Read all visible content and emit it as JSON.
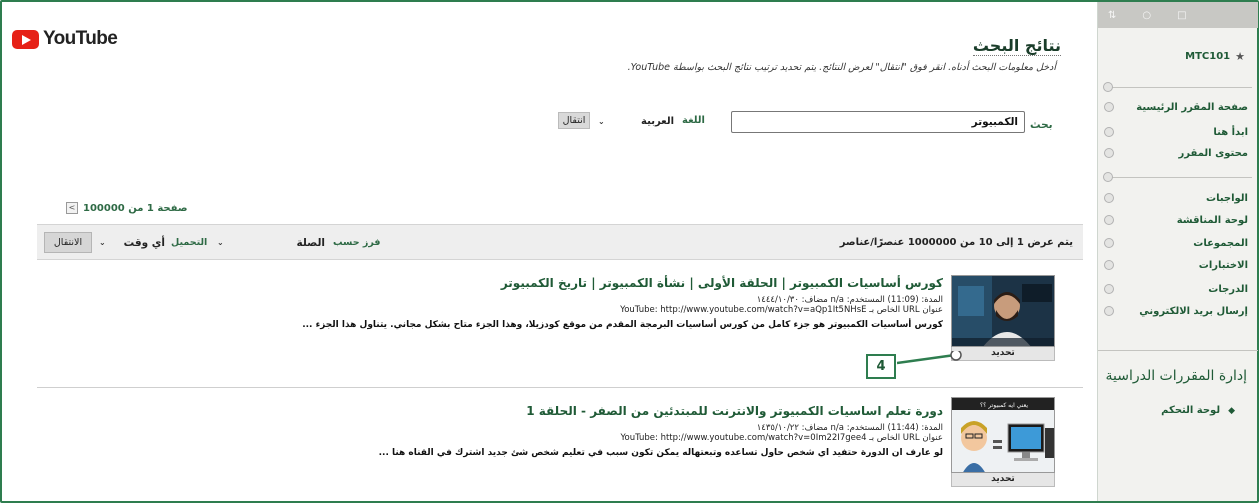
{
  "brand": {
    "logo_text": "YouTube"
  },
  "header": {
    "title": "نتائج البحث",
    "instructions": "أدخل معلومات البحث أدناه. انقر فوق \"انتقال\" لعرض النتائج. يتم تحديد ترتيب نتائج البحث بواسطة YouTube."
  },
  "search": {
    "label": "بحث",
    "value": "الكمبيوتر",
    "language_label": "اللغة",
    "language_value": "العربية",
    "go_label": "انتقال"
  },
  "pager": {
    "text": "صفحة 1 من 100000",
    "arrow": "<"
  },
  "sortbar": {
    "count_text": "يتم عرض 1 إلى 10 من 1000000 عنصرًا/عناصر",
    "sort_label": "فرز حسب",
    "sort_value": "الصلة",
    "upload_label": "التحميل",
    "upload_value": "أي وقت",
    "go_label": "الانتقال"
  },
  "results": [
    {
      "title": "كورس أساسيات الكمبيوتر | الحلقة الأولى | نشأة الكمبيوتر | تاريخ الكمبيوتر",
      "meta_line1": "المدة: (11:09) المستخدم: n/a مضاف: ١٤٤٤/١٠/٣٠",
      "meta_line2": "عنوان URL الخاص بـ YouTube: http://www.youtube.com/watch?v=aQp1It5NHsE",
      "description": "كورس أساسيات الكمبيوتر هو جزء كامل من كورس أساسيات البرمجة المقدم من موقع كودزيلا، وهذا الجزء متاح بشكل مجاني. يتناول هذا الجزء ...",
      "select_label": "تحديد"
    },
    {
      "title": "دورة تعلم اساسيات الكمبيوتر والانترنت للمبتدئين من الصفر - الحلقة 1",
      "meta_line1": "المدة: (11:44) المستخدم: n/a مضاف: ١٤٣٥/١٠/٢٢",
      "meta_line2": "عنوان URL الخاص بـ YouTube: http://www.youtube.com/watch?v=0Im22I7gee4",
      "description": "لو عارف ان الدورة حتفيد اي شخص حاول تساعده وتبعتهاله يمكن تكون سبب في تعليم شخص شئ جديد اشترك في القناه هنا ...",
      "select_label": "تحديد",
      "thumb_caption": "يعني ايه كمبيوتر ؟؟"
    }
  ],
  "callout": {
    "number": "4"
  },
  "sidebar": {
    "course_code": "MTC101",
    "items": [
      {
        "label": "صفحة المقرر الرئيسية"
      },
      {
        "label": "ابدأ هنا"
      },
      {
        "label": "محتوى المقرر"
      },
      {
        "label": "الواجبات"
      },
      {
        "label": "لوحة المناقشة"
      },
      {
        "label": "المجموعات"
      },
      {
        "label": "الاختبارات"
      },
      {
        "label": "الدرجات"
      },
      {
        "label": "إرسال بريد الالكتروني"
      }
    ],
    "admin_title": "إدارة المقررات الدراسية",
    "control_panel": "لوحة التحكم"
  },
  "colors": {
    "accent": "#2e7d4f",
    "link": "#1f5a36",
    "youtube_red": "#e62117"
  }
}
